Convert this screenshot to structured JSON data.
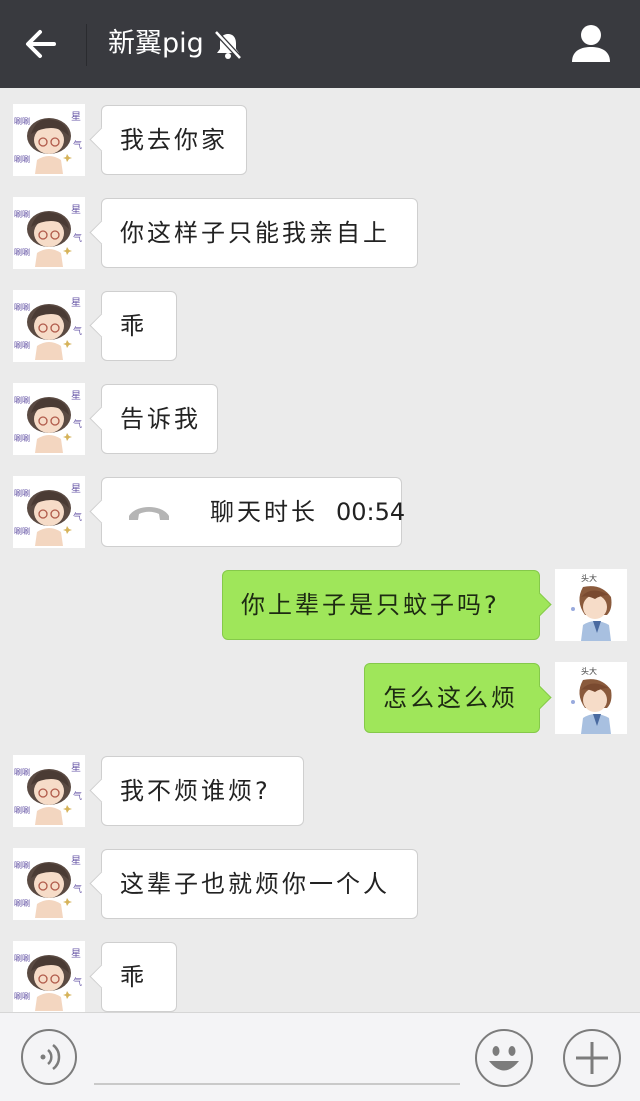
{
  "header": {
    "title": "新翼pig",
    "back_icon": "arrow-left-icon",
    "mute_icon": "bell-muted-icon",
    "profile_icon": "user-icon"
  },
  "messages": [
    {
      "side": "left",
      "text": "我去你家"
    },
    {
      "side": "left",
      "text": "你这样子只能我亲自上"
    },
    {
      "side": "left",
      "text": "乖"
    },
    {
      "side": "left",
      "text": "告诉我"
    },
    {
      "side": "left",
      "type": "call",
      "label": "聊天时长",
      "duration": "00:54"
    },
    {
      "side": "right",
      "text": "你上辈子是只蚊子吗?"
    },
    {
      "side": "right",
      "text": "怎么这么烦"
    },
    {
      "side": "left",
      "text": "我不烦谁烦?"
    },
    {
      "side": "left",
      "text": "这辈子也就烦你一个人"
    },
    {
      "side": "left",
      "text": "乖"
    }
  ],
  "avatars": {
    "left_caption": [
      "星",
      "气",
      "唰唰"
    ],
    "right_caption": "头大"
  },
  "input": {
    "voice_icon": "voice-icon",
    "emoji_icon": "emoji-icon",
    "plus_icon": "plus-icon"
  },
  "colors": {
    "header_bg": "#393a3f",
    "chat_bg": "#ebebeb",
    "bubble_left": "#ffffff",
    "bubble_right": "#9fe65a"
  }
}
